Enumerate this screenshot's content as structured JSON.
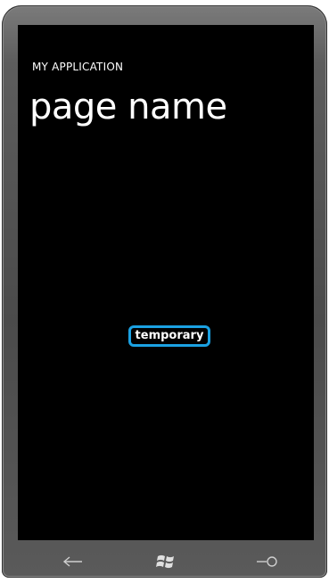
{
  "app": {
    "title": "MY APPLICATION"
  },
  "page": {
    "title": "page name"
  },
  "content": {
    "button_label": "temporary"
  },
  "nav": {
    "items": [
      {
        "icon": "back-arrow-icon"
      },
      {
        "icon": "windows-start-icon"
      },
      {
        "icon": "search-icon"
      }
    ]
  },
  "colors": {
    "accent": "#1ba1e2",
    "background": "#000000",
    "foreground": "#ffffff",
    "bezel": "#555555"
  }
}
